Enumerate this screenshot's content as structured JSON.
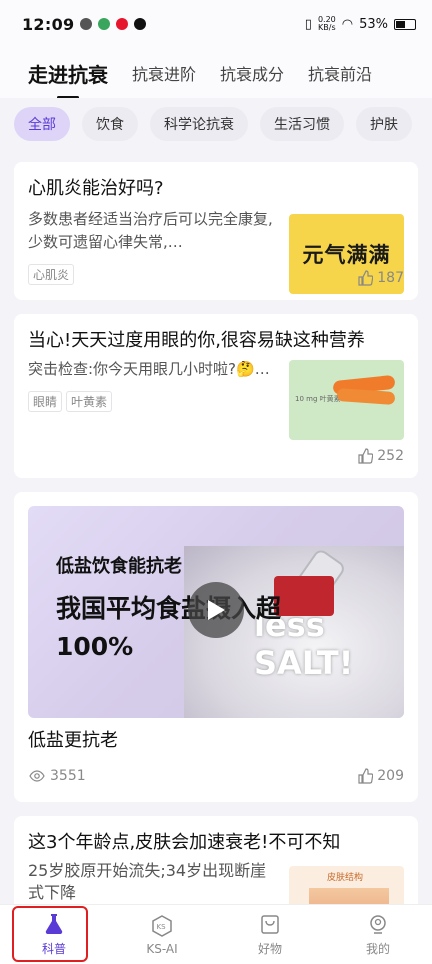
{
  "status": {
    "time": "12:09",
    "net_rate": "0.20",
    "net_unit": "KB/s",
    "battery": "53%"
  },
  "topnav": {
    "tabs": [
      "走进抗衰",
      "抗衰进阶",
      "抗衰成分",
      "抗衰前沿"
    ]
  },
  "chips": [
    "全部",
    "饮食",
    "科学论抗衰",
    "生活习惯",
    "护肤"
  ],
  "cards": [
    {
      "title": "心肌炎能治好吗?",
      "desc": "多数患者经适当治疗后可以完全康复,少数可遗留心律失常,…",
      "tags": [
        "心肌炎"
      ],
      "likes": "187",
      "thumb_text": "元气满满"
    },
    {
      "title": "当心!天天过度用眼的你,很容易缺这种营养",
      "desc": "突击检查:你今天用眼几小时啦?🤔…",
      "tags": [
        "眼睛",
        "叶黄素"
      ],
      "likes": "252",
      "thumb_text": "10 mg 叶黄素"
    }
  ],
  "video_card": {
    "sub": "低盐饮食能抗老",
    "main": "我国平均食盐摄入超100%",
    "salt_text": "less SALT!",
    "title": "低盐更抗老",
    "views": "3551",
    "likes": "209"
  },
  "partial_card": {
    "title": "这3个年龄点,皮肤会加速衰老!不可不知",
    "desc": "25岁胶原开始流失;34岁出现断崖式下降",
    "thumb_text": "皮肤结构"
  },
  "bottomnav": [
    {
      "label": "科普",
      "icon": "flask-icon"
    },
    {
      "label": "KS-AI",
      "icon": "ks-ai-icon"
    },
    {
      "label": "好物",
      "icon": "shopping-bag-icon"
    },
    {
      "label": "我的",
      "icon": "profile-icon"
    }
  ],
  "colors": {
    "accent": "#5b3bd6",
    "highlight": "#e02020"
  }
}
